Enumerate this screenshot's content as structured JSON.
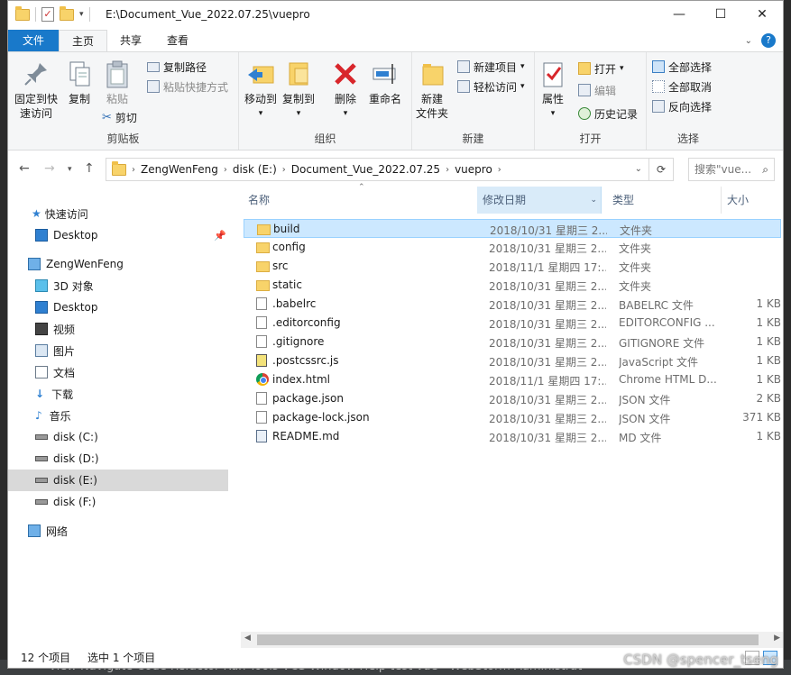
{
  "window": {
    "title": "E:\\Document_Vue_2022.07.25\\vuepro",
    "minimize": "—",
    "maximize": "☐",
    "close": "✕"
  },
  "tabs": {
    "file": "文件",
    "home": "主页",
    "share": "共享",
    "view": "查看",
    "help": "?"
  },
  "ribbon": {
    "clipboard": {
      "label": "剪贴板",
      "pin_quick": "固定到快速访问",
      "pin_quick_l1": "固定到快",
      "pin_quick_l2": "速访问",
      "copy": "复制",
      "paste": "粘贴",
      "copy_path": "复制路径",
      "paste_shortcut": "粘贴快捷方式",
      "cut": "剪切"
    },
    "organize": {
      "label": "组织",
      "move_to": "移动到",
      "copy_to": "复制到",
      "delete": "删除",
      "rename": "重命名"
    },
    "new": {
      "label": "新建",
      "new_folder_l1": "新建",
      "new_folder_l2": "文件夹",
      "new_item": "新建项目",
      "easy_access": "轻松访问"
    },
    "open": {
      "label": "打开",
      "properties": "属性",
      "open": "打开",
      "edit": "编辑",
      "history": "历史记录"
    },
    "select": {
      "label": "选择",
      "select_all": "全部选择",
      "select_none": "全部取消",
      "invert": "反向选择"
    }
  },
  "address": {
    "crumbs": [
      "ZengWenFeng",
      "disk (E:)",
      "Document_Vue_2022.07.25",
      "vuepro"
    ],
    "search_placeholder": "搜索\"vue...",
    "refresh": "⟳"
  },
  "nav": {
    "quick_access": "快速访问",
    "desktop_pinned": "Desktop",
    "pc": "ZengWenFeng",
    "items": [
      "3D 对象",
      "Desktop",
      "视频",
      "图片",
      "文档",
      "下载",
      "音乐",
      "disk (C:)",
      "disk (D:)",
      "disk (E:)",
      "disk (F:)"
    ],
    "network": "网络"
  },
  "columns": {
    "name": "名称",
    "date": "修改日期",
    "type": "类型",
    "size": "大小"
  },
  "files": [
    {
      "name": "build",
      "date": "2018/10/31 星期三 2...",
      "type": "文件夹",
      "size": "",
      "icon": "folder"
    },
    {
      "name": "config",
      "date": "2018/10/31 星期三 2...",
      "type": "文件夹",
      "size": "",
      "icon": "folder"
    },
    {
      "name": "src",
      "date": "2018/11/1 星期四 17:...",
      "type": "文件夹",
      "size": "",
      "icon": "folder"
    },
    {
      "name": "static",
      "date": "2018/10/31 星期三 2...",
      "type": "文件夹",
      "size": "",
      "icon": "folder"
    },
    {
      "name": ".babelrc",
      "date": "2018/10/31 星期三 2...",
      "type": "BABELRC 文件",
      "size": "1 KB",
      "icon": "doc"
    },
    {
      "name": ".editorconfig",
      "date": "2018/10/31 星期三 2...",
      "type": "EDITORCONFIG ...",
      "size": "1 KB",
      "icon": "doc"
    },
    {
      "name": ".gitignore",
      "date": "2018/10/31 星期三 2...",
      "type": "GITIGNORE 文件",
      "size": "1 KB",
      "icon": "doc"
    },
    {
      "name": ".postcssrc.js",
      "date": "2018/10/31 星期三 2...",
      "type": "JavaScript 文件",
      "size": "1 KB",
      "icon": "js"
    },
    {
      "name": "index.html",
      "date": "2018/11/1 星期四 17:...",
      "type": "Chrome HTML D...",
      "size": "1 KB",
      "icon": "chrome"
    },
    {
      "name": "package.json",
      "date": "2018/10/31 星期三 2...",
      "type": "JSON 文件",
      "size": "2 KB",
      "icon": "doc"
    },
    {
      "name": "package-lock.json",
      "date": "2018/10/31 星期三 2...",
      "type": "JSON 文件",
      "size": "371 KB",
      "icon": "doc"
    },
    {
      "name": "README.md",
      "date": "2018/10/31 星期三 2...",
      "type": "MD 文件",
      "size": "1 KB",
      "icon": "md"
    }
  ],
  "status": {
    "count": "12 个项目",
    "selected": "选中 1 个项目"
  },
  "background_app": {
    "menu": "View  Navigate  Code  Refactor  Run  Tools  VCS  Window  Help      test-vue - WebStorm  Administrat"
  },
  "watermark": "CSDN @spencer_tseng"
}
